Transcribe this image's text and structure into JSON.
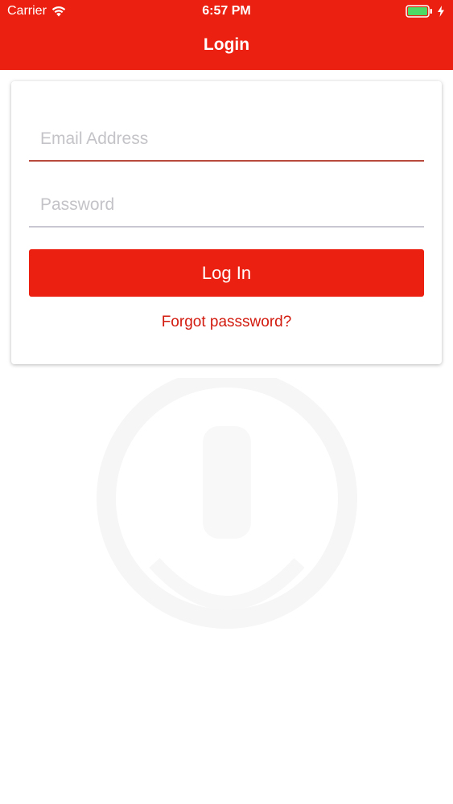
{
  "status_bar": {
    "carrier": "Carrier",
    "time": "6:57 PM",
    "icons": [
      "wifi-icon",
      "battery-icon",
      "charging-bolt-icon"
    ]
  },
  "header": {
    "title": "Login",
    "background_color": "#ec2010"
  },
  "form": {
    "email_placeholder": "Email Address",
    "email_value": "",
    "password_placeholder": "Password",
    "password_value": "",
    "login_label": "Log In",
    "forgot_label": "Forgot passsword?"
  },
  "colors": {
    "accent": "#ec2010",
    "link": "#d21a0e",
    "email_underline": "#b84a3d",
    "password_underline": "#c9c7d1",
    "battery": "#4cd964"
  }
}
